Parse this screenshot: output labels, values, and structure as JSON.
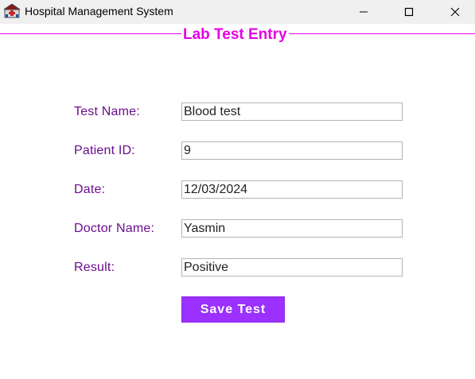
{
  "window": {
    "title": "Hospital Management System",
    "icons": {
      "app": "hospital-app-icon",
      "minimize": "minimize-icon",
      "maximize": "maximize-icon",
      "close": "close-icon"
    }
  },
  "form": {
    "title": "Lab Test Entry",
    "fields": [
      {
        "label": "Test Name:",
        "value": "Blood test"
      },
      {
        "label": "Patient ID:",
        "value": "9"
      },
      {
        "label": "Date:",
        "value": "12/03/2024"
      },
      {
        "label": "Doctor Name:",
        "value": "Yasmin"
      },
      {
        "label": "Result:",
        "value": "Positive"
      }
    ],
    "save_label": "Save Test"
  },
  "colors": {
    "title_accent": "#e600e6",
    "label_text": "#6b0d8e",
    "button_bg": "#9b30ff",
    "button_text": "#ffffff"
  }
}
